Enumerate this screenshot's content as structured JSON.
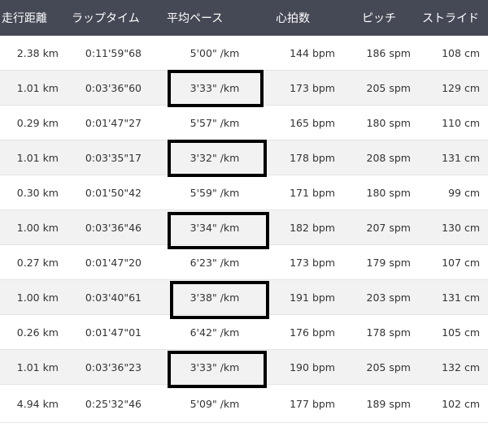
{
  "header": {
    "distance": "走行距離",
    "lap_time": "ラップタイム",
    "avg_pace": "平均ペース",
    "heart_rate": "心拍数",
    "pitch": "ピッチ",
    "stride": "ストライド"
  },
  "rows": [
    {
      "distance": "2.38 km",
      "lap_time": "0:11'59\"68",
      "pace": "5'00\" /km",
      "heart_rate": "144 bpm",
      "pitch": "186 spm",
      "stride": "108 cm"
    },
    {
      "distance": "1.01 km",
      "lap_time": "0:03'36\"60",
      "pace": "3'33\" /km",
      "heart_rate": "173 bpm",
      "pitch": "205 spm",
      "stride": "129 cm"
    },
    {
      "distance": "0.29 km",
      "lap_time": "0:01'47\"27",
      "pace": "5'57\" /km",
      "heart_rate": "165 bpm",
      "pitch": "180 spm",
      "stride": "110 cm"
    },
    {
      "distance": "1.01 km",
      "lap_time": "0:03'35\"17",
      "pace": "3'32\" /km",
      "heart_rate": "178 bpm",
      "pitch": "208 spm",
      "stride": "131 cm"
    },
    {
      "distance": "0.30 km",
      "lap_time": "0:01'50\"42",
      "pace": "5'59\" /km",
      "heart_rate": "171 bpm",
      "pitch": "180 spm",
      "stride": "99 cm"
    },
    {
      "distance": "1.00 km",
      "lap_time": "0:03'36\"46",
      "pace": "3'34\" /km",
      "heart_rate": "182 bpm",
      "pitch": "207 spm",
      "stride": "130 cm"
    },
    {
      "distance": "0.27 km",
      "lap_time": "0:01'47\"20",
      "pace": "6'23\" /km",
      "heart_rate": "173 bpm",
      "pitch": "179 spm",
      "stride": "107 cm"
    },
    {
      "distance": "1.00 km",
      "lap_time": "0:03'40\"61",
      "pace": "3'38\" /km",
      "heart_rate": "191 bpm",
      "pitch": "203 spm",
      "stride": "131 cm"
    },
    {
      "distance": "0.26 km",
      "lap_time": "0:01'47\"01",
      "pace": "6'42\" /km",
      "heart_rate": "176 bpm",
      "pitch": "178 spm",
      "stride": "105 cm"
    },
    {
      "distance": "1.01 km",
      "lap_time": "0:03'36\"23",
      "pace": "3'33\" /km",
      "heart_rate": "190 bpm",
      "pitch": "205 spm",
      "stride": "132 cm"
    },
    {
      "distance": "4.94 km",
      "lap_time": "0:25'32\"46",
      "pace": "5'09\" /km",
      "heart_rate": "177 bpm",
      "pitch": "189 spm",
      "stride": "102 cm"
    }
  ],
  "colors": {
    "header_bg": "#454855",
    "header_text": "#ffffff",
    "row_alt_bg": "#f2f2f2",
    "highlight_border": "#000000"
  }
}
